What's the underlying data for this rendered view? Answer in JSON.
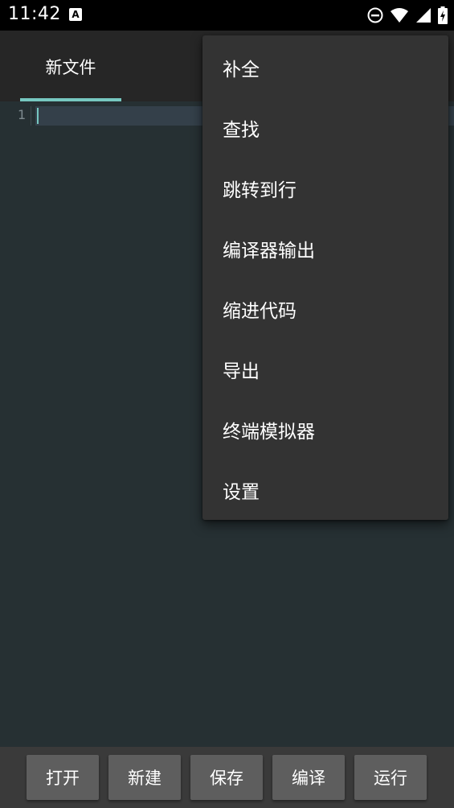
{
  "status_bar": {
    "time": "11:42",
    "notification_icon_letter": "A",
    "icons": [
      "do-not-disturb-icon",
      "wifi-icon",
      "cell-signal-icon",
      "battery-charging-icon"
    ]
  },
  "tabs": [
    {
      "label": "新文件",
      "active": true
    }
  ],
  "editor": {
    "line_numbers": [
      "1"
    ],
    "content": ""
  },
  "overflow_menu": {
    "items": [
      {
        "label": "补全"
      },
      {
        "label": "查找"
      },
      {
        "label": "跳转到行"
      },
      {
        "label": "编译器输出"
      },
      {
        "label": "缩进代码"
      },
      {
        "label": "导出"
      },
      {
        "label": "终端模拟器"
      },
      {
        "label": "设置"
      }
    ]
  },
  "toolbar": {
    "buttons": [
      {
        "label": "打开"
      },
      {
        "label": "新建"
      },
      {
        "label": "保存"
      },
      {
        "label": "编译"
      },
      {
        "label": "运行"
      }
    ]
  },
  "colors": {
    "accent": "#76c7c0",
    "editor_bg": "#263033",
    "menu_bg": "#333333",
    "toolbar_bg": "#3a3a3a",
    "button_bg": "#5e5e5e"
  }
}
